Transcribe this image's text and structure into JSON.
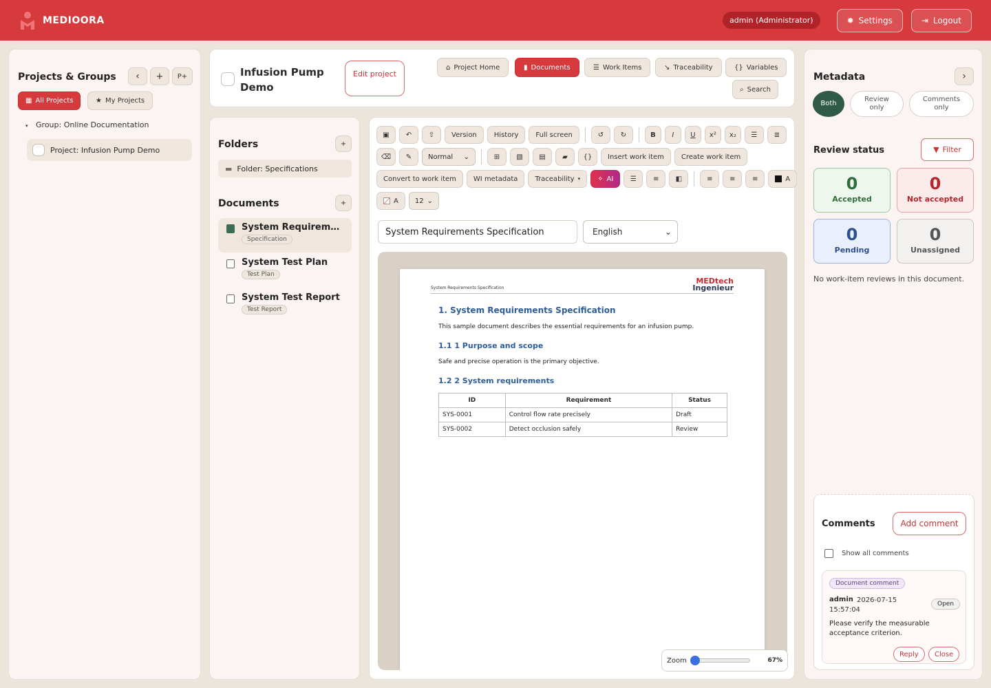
{
  "app": {
    "brand": "MEDIOORA",
    "user": "admin (Administrator)",
    "settings_label": "Settings",
    "logout_label": "Logout"
  },
  "projects_panel": {
    "title": "Projects & Groups",
    "collapse_label": "‹",
    "add_label": "+",
    "p_plus_label": "P+",
    "all_projects_label": "All Projects",
    "my_projects_label": "My Projects",
    "group_label": "Group: Online Documentation",
    "project_label": "Project: Infusion Pump Demo"
  },
  "project_header": {
    "title": "Infusion Pump Demo",
    "edit_label": "Edit project",
    "nav": {
      "home": "Project Home",
      "documents": "Documents",
      "work_items": "Work Items",
      "traceability": "Traceability",
      "variables": "Variables",
      "search": "Search"
    }
  },
  "folders_panel": {
    "folders_title": "Folders",
    "add_label": "+",
    "folder_label": "Folder: Specifications",
    "documents_title": "Documents",
    "documents": [
      {
        "title": "System Requirement...",
        "tag": "Specification"
      },
      {
        "title": "System Test Plan",
        "tag": "Test Plan"
      },
      {
        "title": "System Test Report",
        "tag": "Test Report"
      }
    ]
  },
  "editor": {
    "toolbar": {
      "version": "Version",
      "history": "History",
      "fullscreen": "Full screen",
      "bold": "B",
      "italic": "I",
      "underline": "U",
      "superscript": "x²",
      "subscript": "x₂",
      "style_select": "Normal",
      "insert_work_item": "Insert work item",
      "create_work_item": "Create work item",
      "convert_to_work_item": "Convert to work item",
      "wi_metadata": "WI metadata",
      "traceability": "Traceability",
      "ai": "AI",
      "text_color_label": "A",
      "bg_color_label": "A",
      "font_size": "12"
    },
    "doc_title": "System Requirements Specification",
    "language": "English",
    "page": {
      "header_text": "System Requirements Specification",
      "logo_line1": "MEDtech",
      "logo_line2": "Ingenieur",
      "h1": "1.  System Requirements Specification",
      "intro": "This sample document describes the essential requirements for an infusion pump.",
      "h2a": "1.1  1 Purpose and scope",
      "p2": "Safe and precise operation is the primary objective.",
      "h2b": "1.2  2 System requirements",
      "table": {
        "headers": [
          "ID",
          "Requirement",
          "Status"
        ],
        "rows": [
          [
            "SYS-0001",
            "Control flow rate precisely",
            "Draft"
          ],
          [
            "SYS-0002",
            "Detect occlusion safely",
            "Review"
          ]
        ]
      }
    },
    "zoom_label": "Zoom",
    "zoom_value": "67%",
    "zoom_fraction": 0.0
  },
  "metadata_panel": {
    "title": "Metadata",
    "expand_label": "›",
    "view_both": "Both",
    "view_review": "Review only",
    "view_comments": "Comments only",
    "review_status_title": "Review status",
    "filter_label": "Filter",
    "accepted_count": "0",
    "accepted_label": "Accepted",
    "not_accepted_count": "0",
    "not_accepted_label": "Not accepted",
    "pending_count": "0",
    "pending_label": "Pending",
    "unassigned_count": "0",
    "unassigned_label": "Unassigned",
    "no_reviews_text": "No work-item reviews in this document.",
    "comments_title": "Comments",
    "add_comment_label": "Add comment",
    "show_all_label": "Show all comments",
    "comment": {
      "type": "Document comment",
      "author": "admin",
      "timestamp": "2026-07-15 15:57:04",
      "status": "Open",
      "text": "Please verify the measurable acceptance criterion.",
      "reply_label": "Reply",
      "close_label": "Close"
    }
  },
  "colors": {
    "brand_red": "#d63a3c",
    "accepted_green": "#2f6b3b",
    "not_accepted_red": "#b3272b",
    "pending_blue": "#2d4f8e",
    "unassigned_gray": "#555555"
  }
}
